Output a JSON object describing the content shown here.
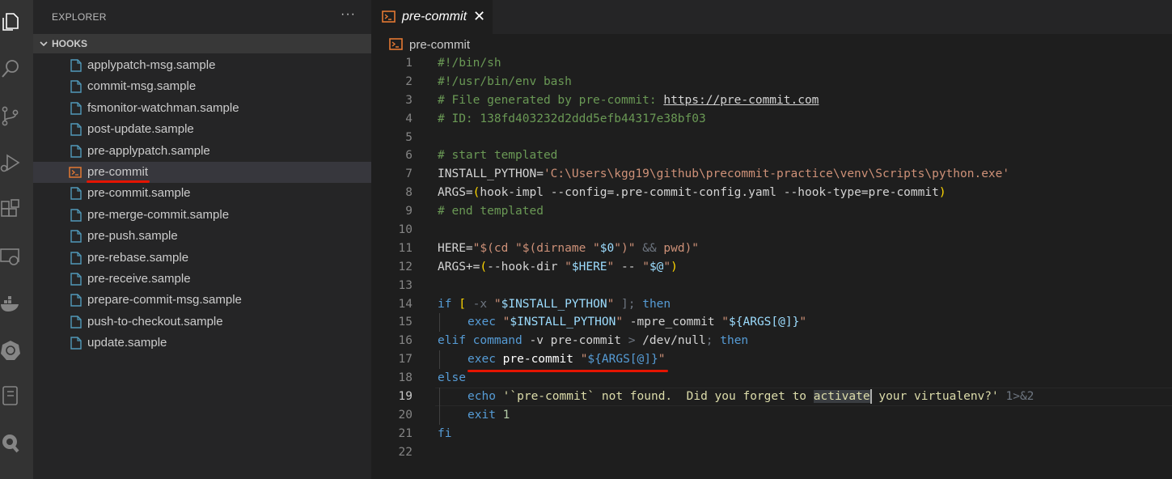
{
  "activity_bar": {
    "icons": [
      "explorer-icon",
      "search-icon",
      "source-control-icon",
      "run-debug-icon",
      "extensions-icon",
      "remote-explorer-icon",
      "docker-icon",
      "kubernetes-icon",
      "notebook-icon",
      "q-icon"
    ]
  },
  "explorer": {
    "title": "EXPLORER",
    "more": "···",
    "section": "HOOKS",
    "files": [
      {
        "label": "applypatch-msg.sample"
      },
      {
        "label": "commit-msg.sample"
      },
      {
        "label": "fsmonitor-watchman.sample"
      },
      {
        "label": "post-update.sample"
      },
      {
        "label": "pre-applypatch.sample"
      },
      {
        "label": "pre-commit"
      },
      {
        "label": "pre-commit.sample"
      },
      {
        "label": "pre-merge-commit.sample"
      },
      {
        "label": "pre-push.sample"
      },
      {
        "label": "pre-rebase.sample"
      },
      {
        "label": "pre-receive.sample"
      },
      {
        "label": "prepare-commit-msg.sample"
      },
      {
        "label": "push-to-checkout.sample"
      },
      {
        "label": "update.sample"
      }
    ],
    "selected_index": 5
  },
  "editor": {
    "tab_label": "pre-commit",
    "tab_close": "✕",
    "breadcrumb": "pre-commit",
    "line_numbers": [
      "1",
      "2",
      "3",
      "4",
      "5",
      "6",
      "7",
      "8",
      "9",
      "10",
      "11",
      "12",
      "13",
      "14",
      "15",
      "16",
      "17",
      "18",
      "19",
      "20",
      "21",
      "22"
    ],
    "code": {
      "l1": "#!/bin/sh",
      "l2": "#!/usr/bin/env bash",
      "l3a": "# File generated by pre-commit: ",
      "l3b": "https://pre-commit.com",
      "l4": "# ID: 138fd403232d2ddd5efb44317e38bf03",
      "l6": "# start templated",
      "l7a": "INSTALL_PYTHON=",
      "l7b": "'C:\\Users\\kgg19\\github\\precommit-practice\\venv\\Scripts\\python.exe'",
      "l8a": "ARGS=",
      "l8b": "(",
      "l8c": "hook-impl --config=.pre-commit-config.yaml --hook-type=pre-commit",
      "l8d": ")",
      "l9": "# end templated",
      "l11a": "HERE=",
      "l11b": "\"$(cd \"$(dirname \"",
      "l11c": "$0",
      "l11d": "\")\" ",
      "l11e": "&&",
      "l11f": " pwd)\"",
      "l12a": "ARGS+=",
      "l12b": "(",
      "l12c": "--hook-dir ",
      "l12d": "\"",
      "l12e": "$HERE",
      "l12f": "\"",
      "l12g": " -- ",
      "l12h": "\"",
      "l12i": "$@",
      "l12j": "\"",
      "l12k": ")",
      "l14a": "if",
      "l14b": " [ ",
      "l14c": "-x",
      "l14d": " \"",
      "l14e": "$INSTALL_PYTHON",
      "l14f": "\"",
      "l14g": " ]; ",
      "l14h": "then",
      "l15a": "exec",
      "l15b": " \"",
      "l15c": "$INSTALL_PYTHON",
      "l15d": "\"",
      "l15e": " -mpre_commit ",
      "l15f": "\"",
      "l15g": "${ARGS[@]}",
      "l15h": "\"",
      "l16a": "elif",
      "l16b": " command",
      "l16c": " -v pre-commit ",
      "l16d": ">",
      "l16e": " /dev/null",
      "l16f": "; ",
      "l16g": "then",
      "l17a": "exec",
      "l17b": " pre-commit ",
      "l17c": "\"",
      "l17d": "${ARGS[@]}",
      "l17e": "\"",
      "l18": "else",
      "l19a": "echo",
      "l19b": " '`pre-commit` not found.  Did you forget to ",
      "l19c": "activate",
      "l19d": " your virtualenv?'",
      "l19e": " 1>&2",
      "l20a": "exit",
      "l20b": " 1",
      "l21": "fi"
    }
  },
  "colors": {
    "accent_underline": "#e51400",
    "terminal_icon": "#e37933",
    "file_icon": "#519aba"
  }
}
